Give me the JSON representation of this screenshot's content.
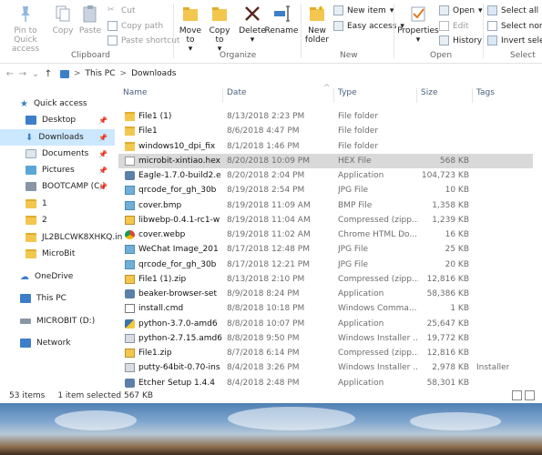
{
  "ribbon": {
    "clipboard": {
      "pin_label": "Pin to Quick access",
      "copy_label": "Copy",
      "paste_label": "Paste",
      "cut_label": "Cut",
      "copy_path_label": "Copy path",
      "paste_shortcut_label": "Paste shortcut",
      "group_label": "Clipboard"
    },
    "organize": {
      "move_label": "Move to",
      "copy_to_label": "Copy to",
      "delete_label": "Delete",
      "rename_label": "Rename",
      "group_label": "Organize"
    },
    "new": {
      "new_folder_label": "New folder",
      "new_item_label": "New item",
      "easy_access_label": "Easy access",
      "group_label": "New"
    },
    "open": {
      "properties_label": "Properties",
      "open_label": "Open",
      "edit_label": "Edit",
      "history_label": "History",
      "group_label": "Open"
    },
    "select": {
      "select_all_label": "Select all",
      "select_none_label": "Select none",
      "invert_label": "Invert selection",
      "group_label": "Select"
    }
  },
  "address": {
    "back": "←",
    "forward": "→",
    "dropdown": "⌄",
    "up": "↑",
    "crumbs": [
      "This PC",
      "Downloads"
    ],
    "separator": ">"
  },
  "sidebar": {
    "items": [
      {
        "label": "Quick access",
        "pinned": false
      },
      {
        "label": "Desktop",
        "pinned": true
      },
      {
        "label": "Downloads",
        "pinned": true
      },
      {
        "label": "Documents",
        "pinned": true
      },
      {
        "label": "Pictures",
        "pinned": true
      },
      {
        "label": "BOOTCAMP (C:)",
        "pinned": true
      },
      {
        "label": "1",
        "pinned": false
      },
      {
        "label": "2",
        "pinned": false
      },
      {
        "label": "JL2BLCWK8XHKQ.in",
        "pinned": false
      },
      {
        "label": "MicroBit",
        "pinned": false
      },
      {
        "label": "OneDrive",
        "pinned": false
      },
      {
        "label": "This PC",
        "pinned": false
      },
      {
        "label": "MICROBIT (D:)",
        "pinned": false
      },
      {
        "label": "Network",
        "pinned": false
      }
    ],
    "pin_glyph": "📌"
  },
  "columns": {
    "name": "Name",
    "date": "Date",
    "type": "Type",
    "size": "Size",
    "tags": "Tags",
    "sort_arrow": "^"
  },
  "files": [
    {
      "name": "File1 (1)",
      "date": "8/13/2018 2:23 PM",
      "type": "File folder",
      "size": "",
      "tags": "",
      "icon": "folder-icon"
    },
    {
      "name": "File1",
      "date": "8/6/2018 4:47 PM",
      "type": "File folder",
      "size": "",
      "tags": "",
      "icon": "folder-icon"
    },
    {
      "name": "windows10_dpi_fix",
      "date": "8/1/2018 1:46 PM",
      "type": "File folder",
      "size": "",
      "tags": "",
      "icon": "folder-icon"
    },
    {
      "name": "microbit-xintiao.hex",
      "date": "8/20/2018 10:09 PM",
      "type": "HEX File",
      "size": "568 KB",
      "tags": "",
      "icon": "document-icon"
    },
    {
      "name": "Eagle-1.7.0-build2.e",
      "date": "8/20/2018 2:04 PM",
      "type": "Application",
      "size": "104,723 KB",
      "tags": "",
      "icon": "app-icon"
    },
    {
      "name": "qrcode_for_gh_30b",
      "date": "8/19/2018 2:54 PM",
      "type": "JPG File",
      "size": "10 KB",
      "tags": "",
      "icon": "image-icon"
    },
    {
      "name": "cover.bmp",
      "date": "8/19/2018 11:09 AM",
      "type": "BMP File",
      "size": "1,358 KB",
      "tags": "",
      "icon": "image-icon"
    },
    {
      "name": "libwebp-0.4.1-rc1-w",
      "date": "8/19/2018 11:04 AM",
      "type": "Compressed (zipp...",
      "size": "1,239 KB",
      "tags": "",
      "icon": "zip-icon"
    },
    {
      "name": "cover.webp",
      "date": "8/19/2018 11:02 AM",
      "type": "Chrome HTML Do...",
      "size": "16 KB",
      "tags": "",
      "icon": "chrome-icon"
    },
    {
      "name": "WeChat Image_201",
      "date": "8/17/2018 12:48 PM",
      "type": "JPG File",
      "size": "25 KB",
      "tags": "",
      "icon": "image-icon"
    },
    {
      "name": "qrcode_for_gh_30b",
      "date": "8/17/2018 12:21 PM",
      "type": "JPG File",
      "size": "20 KB",
      "tags": "",
      "icon": "image-icon"
    },
    {
      "name": "File1 (1).zip",
      "date": "8/13/2018 2:10 PM",
      "type": "Compressed (zipp...",
      "size": "12,816 KB",
      "tags": "",
      "icon": "zip-icon"
    },
    {
      "name": "beaker-browser-set",
      "date": "8/9/2018 8:24 PM",
      "type": "Application",
      "size": "58,386 KB",
      "tags": "",
      "icon": "app-icon"
    },
    {
      "name": "install.cmd",
      "date": "8/8/2018 10:18 PM",
      "type": "Windows Comma...",
      "size": "1 KB",
      "tags": "",
      "icon": "cmd-icon"
    },
    {
      "name": "python-3.7.0-amd6",
      "date": "8/8/2018 10:07 PM",
      "type": "Application",
      "size": "25,647 KB",
      "tags": "",
      "icon": "python-icon"
    },
    {
      "name": "python-2.7.15.amd6",
      "date": "8/8/2018 9:50 PM",
      "type": "Windows Installer ...",
      "size": "19,772 KB",
      "tags": "",
      "icon": "installer-icon"
    },
    {
      "name": "File1.zip",
      "date": "8/7/2018 6:14 PM",
      "type": "Compressed (zipp...",
      "size": "12,816 KB",
      "tags": "",
      "icon": "zip-icon"
    },
    {
      "name": "putty-64bit-0.70-ins",
      "date": "8/4/2018 3:26 PM",
      "type": "Windows Installer ...",
      "size": "2,978 KB",
      "tags": "Installer",
      "icon": "installer-icon"
    },
    {
      "name": "Etcher Setup 1.4.4",
      "date": "8/4/2018 2:48 PM",
      "type": "Application",
      "size": "58,301 KB",
      "tags": "",
      "icon": "app-icon"
    }
  ],
  "status": {
    "count": "53 items",
    "selected": "1 item selected  567 KB"
  },
  "colors": {
    "selection_sidebar": "#cce8ff",
    "selection_row": "#d9d9d9",
    "folder": "#f3c64e"
  }
}
